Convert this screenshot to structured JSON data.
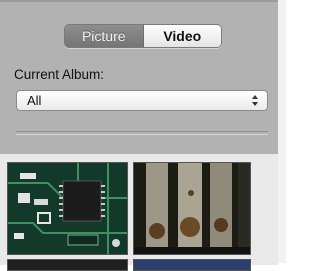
{
  "tabs": [
    {
      "label": "Picture",
      "selected": false
    },
    {
      "label": "Video",
      "selected": true
    }
  ],
  "album": {
    "label": "Current Album:",
    "selected": "All"
  },
  "thumbnails": [
    {
      "name": "circuit-board"
    },
    {
      "name": "metal-contacts"
    },
    {
      "name": "dark-thumbnail"
    },
    {
      "name": "blue-thumbnail"
    }
  ],
  "colors": {
    "panel": "#b2b2b2",
    "selected_tab": "#ffffff",
    "unselected_tab": "#828282"
  }
}
